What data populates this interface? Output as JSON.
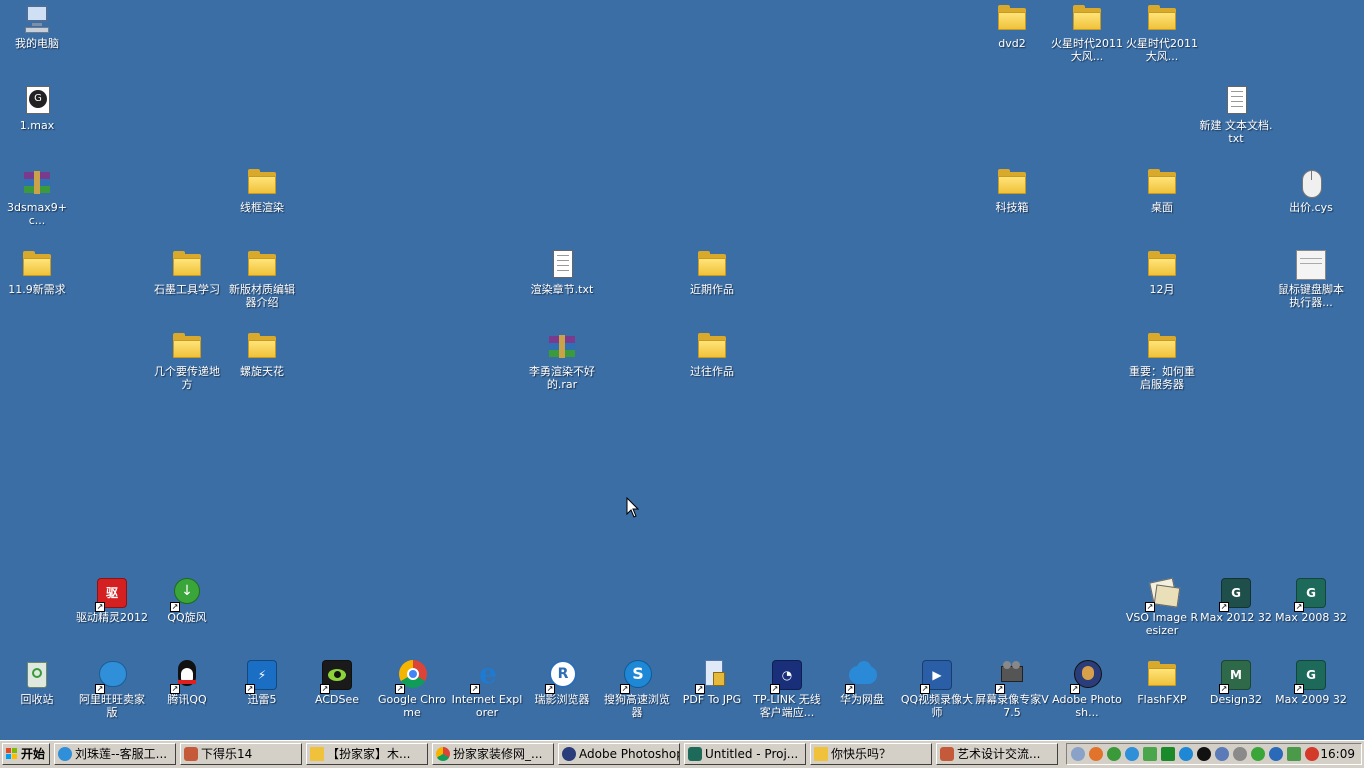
{
  "desktop": {
    "icons": {
      "my_computer": "我的电脑",
      "max_file": "1.max",
      "dvd2": "dvd2",
      "mars_1": "火星时代2011大风...",
      "mars_2": "火星时代2011大风...",
      "new_text": "新建 文本文档.txt",
      "3dsmax_rar": "3dsmax9+c...",
      "wireframe": "线框渲染",
      "tech_box": "科技箱",
      "desk": "桌面",
      "price_cys": "出价.cys",
      "req_11_9": "11.9新需求",
      "graphite": "石墨工具学习",
      "new_material": "新版材质编辑器介绍",
      "render_chapter": "渲染章节.txt",
      "recent_works": "近期作品",
      "dec": "12月",
      "mouse_script": "鼠标键盘脚本执行器...",
      "places": "几个要传递地方",
      "spiral": "螺旋天花",
      "liyong_rar": "李勇渲染不好的.rar",
      "past_works": "过往作品",
      "restart_server": "重要：如何重启服务器",
      "driver_genius": "驱动精灵2012",
      "qq_whirlwind": "QQ旋风",
      "vso": "VSO Image Resizer",
      "max2012": "Max 2012 32",
      "max2008": "Max 2008 32",
      "recycle": "回收站",
      "aliwangwang": "阿里旺旺卖家版",
      "qq": "腾讯QQ",
      "xunlei": "迅雷5",
      "acdsee": "ACDSee",
      "chrome": "Google Chrome",
      "ie": "Internet Explorer",
      "ruiying": "瑞影浏览器",
      "sogou": "搜狗高速浏览器",
      "pdf2jpg": "PDF To JPG",
      "tplink": "TP-LINK 无线客户端应...",
      "huawei": "华为网盘",
      "qqvideo": "QQ视频录像大师",
      "screen_rec": "屏幕录像专家V7.5",
      "photoshop": "Adobe Photosh...",
      "flashfxp": "FlashFXP",
      "design32": "Design32",
      "max2009": "Max 2009 32"
    }
  },
  "taskbar": {
    "start_label": "开始",
    "tasks": [
      "刘珠莲--客服工...",
      "下得乐14",
      "【扮家家】木...",
      "扮家家装修网_...",
      "Adobe Photoshop",
      "Untitled     - Proj...",
      "你快乐吗？",
      "艺术设计交流..."
    ],
    "clock": "16:09"
  },
  "colors": {
    "desktop_bg": "#3a6ea5",
    "taskbar_bg": "#d4d0c8"
  }
}
